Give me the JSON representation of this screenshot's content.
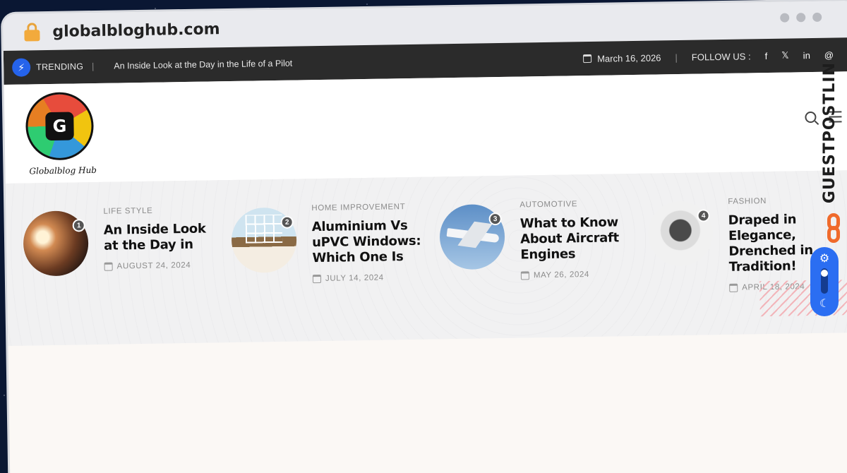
{
  "browser": {
    "url": "globalbloghub.com"
  },
  "topbar": {
    "trending_label": "TRENDING",
    "trending_text": "An Inside Look at the Day in the Life of a Pilot",
    "date": "March 16, 2026",
    "follow_label": "FOLLOW US :",
    "social": [
      "f",
      "𝕏",
      "in",
      "@"
    ]
  },
  "header": {
    "logo_letter": "G",
    "logo_text": "Globalblog Hub"
  },
  "featured": [
    {
      "num": "1",
      "category": "LIFE STYLE",
      "title": "An Inside Look at the Day in",
      "date": "AUGUST 24, 2024"
    },
    {
      "num": "2",
      "category": "HOME IMPROVEMENT",
      "title": "Aluminium Vs uPVC Windows: Which One Is",
      "date": "JULY 14, 2024"
    },
    {
      "num": "3",
      "category": "AUTOMOTIVE",
      "title": "What to Know About Aircraft Engines",
      "date": "MAY 26, 2024"
    },
    {
      "num": "4",
      "category": "FASHION",
      "title": "Draped in Elegance, Drenched in Tradition!",
      "date": "APRIL 18, 2024"
    }
  ],
  "side": {
    "brand": "GUESTPOSTLIN"
  }
}
